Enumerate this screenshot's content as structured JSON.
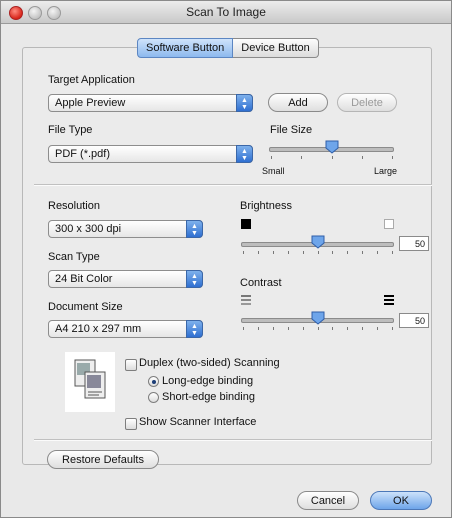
{
  "window": {
    "title": "Scan To Image"
  },
  "tabs": [
    {
      "label": "Software Button",
      "active": true
    },
    {
      "label": "Device Button",
      "active": false
    }
  ],
  "target_application": {
    "label": "Target Application",
    "value": "Apple Preview",
    "add_label": "Add",
    "delete_label": "Delete"
  },
  "file_type": {
    "label": "File Type",
    "value": "PDF (*.pdf)"
  },
  "file_size": {
    "label": "File Size",
    "min_label": "Small",
    "max_label": "Large",
    "level": 0.5
  },
  "resolution": {
    "label": "Resolution",
    "value": "300 x 300 dpi"
  },
  "scan_type": {
    "label": "Scan Type",
    "value": "24 Bit Color"
  },
  "document_size": {
    "label": "Document Size",
    "value": "A4  210 x 297 mm"
  },
  "brightness": {
    "label": "Brightness",
    "value": "50",
    "level": 0.5
  },
  "contrast": {
    "label": "Contrast",
    "value": "50",
    "level": 0.5
  },
  "duplex": {
    "label": "Duplex (two-sided) Scanning",
    "checked": false,
    "long_edge_label": "Long-edge binding",
    "short_edge_label": "Short-edge binding",
    "selected": "long"
  },
  "scanner_interface": {
    "label": "Show Scanner Interface",
    "checked": false
  },
  "buttons": {
    "restore_defaults": "Restore Defaults",
    "cancel": "Cancel",
    "ok": "OK"
  },
  "colors": {
    "accent": "#3f7fd9",
    "window_bg": "#e9e9e9"
  }
}
